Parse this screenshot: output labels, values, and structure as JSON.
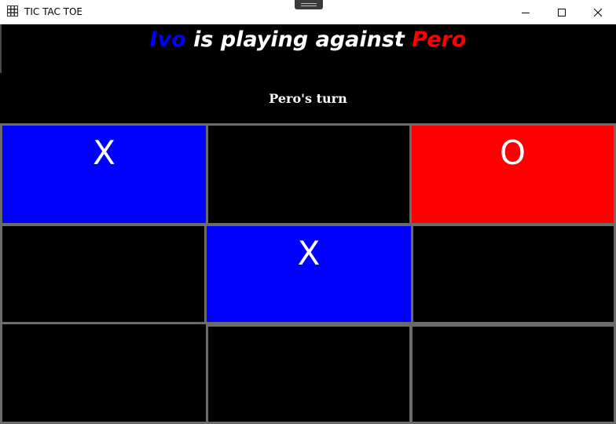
{
  "window": {
    "title": "TIC TAC TOE",
    "icon": "grid-app-icon",
    "controls": [
      "minimize-icon",
      "maximize-icon",
      "close-icon"
    ]
  },
  "header": {
    "player1": "Ivo",
    "middle": " is playing against ",
    "player2": "Pero",
    "player1_color": "#0000ff",
    "player2_color": "#ff0000"
  },
  "status": {
    "turn_text": "Pero's turn"
  },
  "board": {
    "cells": [
      "X",
      "",
      "O",
      "",
      "X",
      "",
      "",
      "",
      ""
    ],
    "x_color": "#0000ff",
    "o_color": "#ff0000",
    "empty_color": "#000000",
    "line_color": "#6b6b6b"
  }
}
